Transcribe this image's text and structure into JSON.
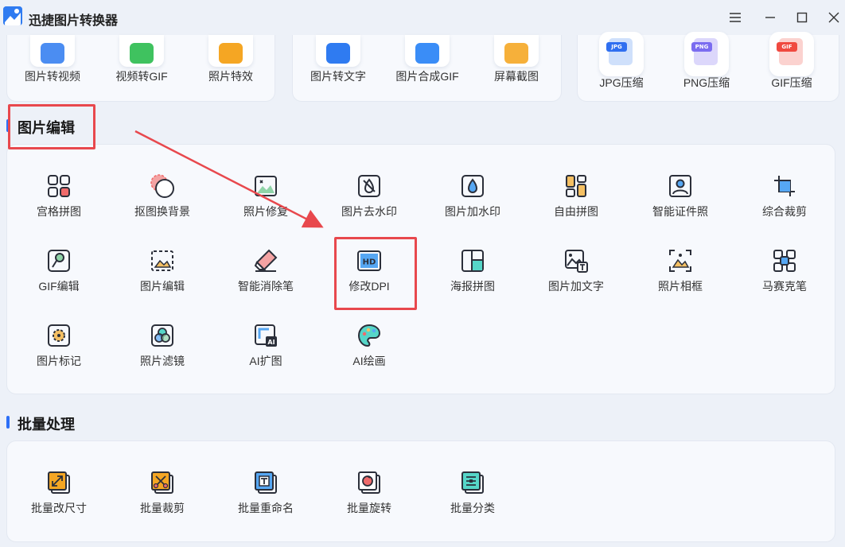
{
  "app": {
    "title": "迅捷图片转换器"
  },
  "top_tools": [
    {
      "label": "图片转视频",
      "icon": "image-to-video-icon",
      "color": "#4b8df2"
    },
    {
      "label": "视频转GIF",
      "icon": "video-to-gif-icon",
      "color": "#3fc25f"
    },
    {
      "label": "照片特效",
      "icon": "photo-effects-icon",
      "color": "#f5a623"
    },
    {
      "label": "图片转文字",
      "icon": "image-to-text-icon",
      "color": "#2f7bf1"
    },
    {
      "label": "图片合成GIF",
      "icon": "images-to-gif-icon",
      "color": "#3a8df7"
    },
    {
      "label": "屏幕截图",
      "icon": "screenshot-icon",
      "color": "#f6b03a"
    }
  ],
  "compress_tools": [
    {
      "label": "JPG压缩",
      "badge": "JPG",
      "color": "#2f6ff0"
    },
    {
      "label": "PNG压缩",
      "badge": "PNG",
      "color": "#7b6cf0"
    },
    {
      "label": "GIF压缩",
      "badge": "GIF",
      "color": "#f0493f"
    }
  ],
  "sections": {
    "edit": {
      "title": "图片编辑",
      "tools": [
        {
          "label": "宫格拼图",
          "icon": "grid-collage-icon"
        },
        {
          "label": "抠图换背景",
          "icon": "cutout-background-icon"
        },
        {
          "label": "照片修复",
          "icon": "photo-repair-icon"
        },
        {
          "label": "图片去水印",
          "icon": "remove-watermark-icon"
        },
        {
          "label": "图片加水印",
          "icon": "add-watermark-icon"
        },
        {
          "label": "自由拼图",
          "icon": "free-collage-icon"
        },
        {
          "label": "智能证件照",
          "icon": "id-photo-icon"
        },
        {
          "label": "综合裁剪",
          "icon": "crop-icon"
        },
        {
          "label": "GIF编辑",
          "icon": "gif-edit-icon"
        },
        {
          "label": "图片编辑",
          "icon": "image-edit-icon"
        },
        {
          "label": "智能消除笔",
          "icon": "eraser-pen-icon"
        },
        {
          "label": "修改DPI",
          "icon": "hd-dpi-icon"
        },
        {
          "label": "海报拼图",
          "icon": "poster-collage-icon"
        },
        {
          "label": "图片加文字",
          "icon": "add-text-icon"
        },
        {
          "label": "照片相框",
          "icon": "photo-frame-icon"
        },
        {
          "label": "马赛克笔",
          "icon": "mosaic-icon"
        },
        {
          "label": "图片标记",
          "icon": "image-mark-icon"
        },
        {
          "label": "照片滤镜",
          "icon": "photo-filter-icon"
        },
        {
          "label": "AI扩图",
          "icon": "ai-expand-icon"
        },
        {
          "label": "AI绘画",
          "icon": "ai-paint-icon"
        }
      ]
    },
    "batch": {
      "title": "批量处理",
      "tools": [
        {
          "label": "批量改尺寸",
          "icon": "batch-resize-icon"
        },
        {
          "label": "批量裁剪",
          "icon": "batch-crop-icon"
        },
        {
          "label": "批量重命名",
          "icon": "batch-rename-icon"
        },
        {
          "label": "批量旋转",
          "icon": "batch-rotate-icon"
        },
        {
          "label": "批量分类",
          "icon": "batch-classify-icon"
        }
      ]
    }
  },
  "colors": {
    "accent": "#2d6ff7",
    "highlight": "#e8484d",
    "icon_stroke": "#2b2f3a",
    "icon_fill_blue": "#56a7f3",
    "icon_fill_orange": "#f5a623",
    "icon_fill_red": "#f06b6b"
  }
}
